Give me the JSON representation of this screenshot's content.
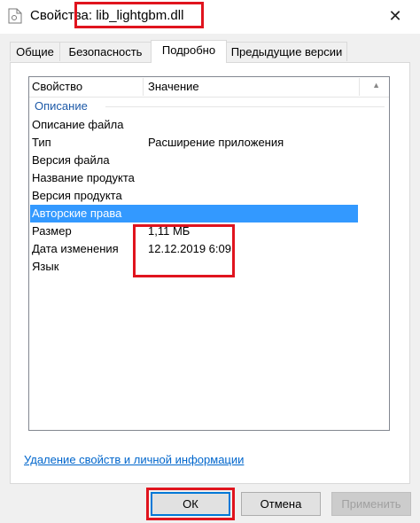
{
  "window": {
    "title": "Свойства: lib_lightgbm.dll",
    "close_glyph": "✕"
  },
  "tabs": [
    {
      "label": "Общие",
      "active": false
    },
    {
      "label": "Безопасность",
      "active": false
    },
    {
      "label": "Подробно",
      "active": true
    },
    {
      "label": "Предыдущие версии",
      "active": false
    }
  ],
  "listview": {
    "columns": [
      "Свойство",
      "Значение"
    ],
    "group": "Описание",
    "rows": [
      {
        "property": "Описание файла",
        "value": ""
      },
      {
        "property": "Тип",
        "value": "Расширение приложения"
      },
      {
        "property": "Версия файла",
        "value": ""
      },
      {
        "property": "Название продукта",
        "value": ""
      },
      {
        "property": "Версия продукта",
        "value": ""
      },
      {
        "property": "Авторские права",
        "value": "",
        "selected": true
      },
      {
        "property": "Размер",
        "value": "1,11 МБ"
      },
      {
        "property": "Дата изменения",
        "value": "12.12.2019 6:09"
      },
      {
        "property": "Язык",
        "value": ""
      }
    ]
  },
  "link": {
    "label": "Удаление свойств и личной информации"
  },
  "buttons": {
    "ok": "ОК",
    "cancel": "Отмена",
    "apply": "Применить"
  },
  "colors": {
    "annotation": "#e0141e",
    "selection": "#3399ff",
    "link": "#0066cc",
    "group_header": "#1e5aa8"
  },
  "icons": {
    "title": "file-icon",
    "close": "close-icon"
  }
}
